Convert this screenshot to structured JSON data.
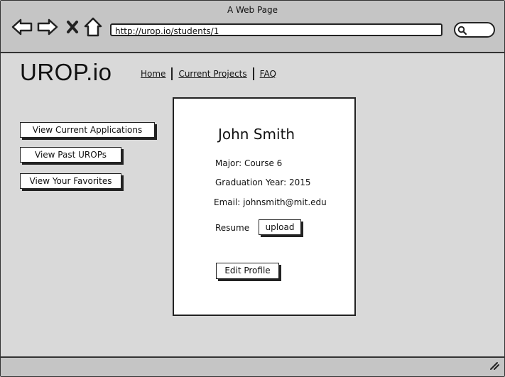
{
  "window": {
    "title": "A Web Page"
  },
  "browser": {
    "url": "http://urop.io/students/1",
    "nav_icons": [
      "back-arrow-icon",
      "forward-arrow-icon",
      "close-x-icon",
      "home-icon"
    ],
    "search_icon": "search-icon"
  },
  "site": {
    "logo": "UROP.io",
    "nav": [
      "Home",
      "Current Projects",
      "FAQ"
    ]
  },
  "sidebar": {
    "buttons": [
      "View Current Applications",
      "View Past UROPs",
      "View Your Favorites"
    ]
  },
  "profile": {
    "name": "John Smith",
    "major": "Major: Course 6",
    "grad_year": "Graduation Year: 2015",
    "email": "Email: johnsmith@mit.edu",
    "resume_label": "Resume",
    "upload_label": "upload",
    "edit_label": "Edit Profile"
  },
  "colors": {
    "chrome": "#c5c5c5",
    "page": "#d9d9d9",
    "card": "#ffffff",
    "stroke": "#222222"
  }
}
